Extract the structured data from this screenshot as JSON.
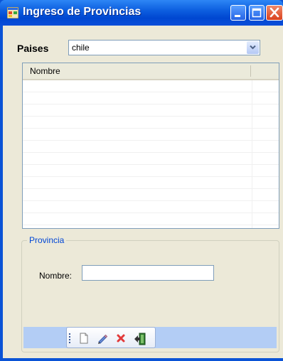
{
  "window": {
    "title": "Ingreso de Provincias"
  },
  "titlebar_buttons": {
    "minimize": "minimize-icon",
    "maximize": "maximize-icon",
    "close": "close-icon"
  },
  "filter": {
    "label": "Paises",
    "selected": "chile"
  },
  "grid": {
    "columns": [
      "Nombre"
    ],
    "rows": []
  },
  "group": {
    "title": "Provincia",
    "nombre_label": "Nombre:",
    "nombre_value": ""
  },
  "toolbar": {
    "buttons": [
      "new-icon",
      "edit-icon",
      "delete-icon",
      "exit-icon"
    ]
  },
  "colors": {
    "titlebar": "#0a53d6",
    "client": "#ece9d8",
    "group_title": "#0046d5",
    "toolstrip": "#b3cdf5"
  }
}
